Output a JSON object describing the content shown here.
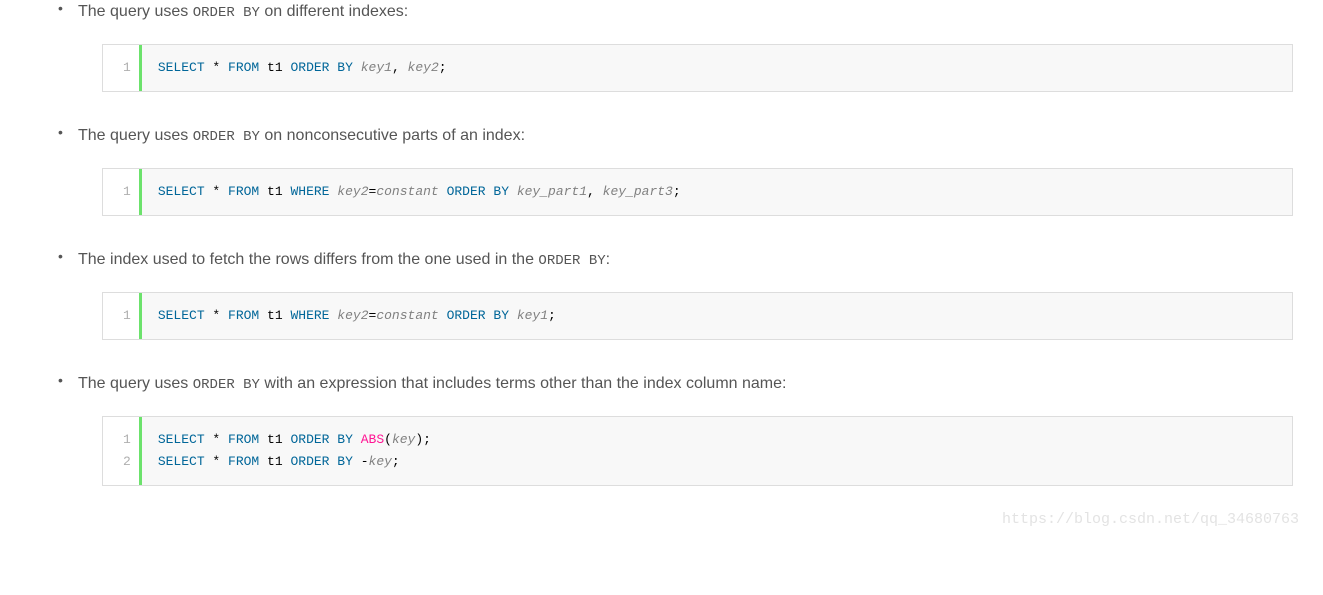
{
  "items": [
    {
      "text_pre": "The query uses ",
      "inline_code": "ORDER BY",
      "text_post": " on different indexes:",
      "line_numbers": [
        "1"
      ],
      "code_lines": [
        [
          {
            "t": "SELECT",
            "c": "kw-blue"
          },
          {
            "t": " * ",
            "c": "plain"
          },
          {
            "t": "FROM",
            "c": "kw-blue"
          },
          {
            "t": " t1 ",
            "c": "plain"
          },
          {
            "t": "ORDER",
            "c": "kw-blue"
          },
          {
            "t": " ",
            "c": "plain"
          },
          {
            "t": "BY",
            "c": "kw-blue"
          },
          {
            "t": " ",
            "c": "plain"
          },
          {
            "t": "key1",
            "c": "gray italic"
          },
          {
            "t": ", ",
            "c": "plain"
          },
          {
            "t": "key2",
            "c": "gray italic"
          },
          {
            "t": ";",
            "c": "plain"
          }
        ]
      ]
    },
    {
      "text_pre": "The query uses ",
      "inline_code": "ORDER BY",
      "text_post": " on nonconsecutive parts of an index:",
      "line_numbers": [
        "1"
      ],
      "code_lines": [
        [
          {
            "t": "SELECT",
            "c": "kw-blue"
          },
          {
            "t": " * ",
            "c": "plain"
          },
          {
            "t": "FROM",
            "c": "kw-blue"
          },
          {
            "t": " t1 ",
            "c": "plain"
          },
          {
            "t": "WHERE",
            "c": "kw-blue"
          },
          {
            "t": " ",
            "c": "plain"
          },
          {
            "t": "key2",
            "c": "gray italic"
          },
          {
            "t": "=",
            "c": "plain"
          },
          {
            "t": "constant",
            "c": "gray italic"
          },
          {
            "t": " ",
            "c": "plain"
          },
          {
            "t": "ORDER",
            "c": "kw-blue"
          },
          {
            "t": " ",
            "c": "plain"
          },
          {
            "t": "BY",
            "c": "kw-blue"
          },
          {
            "t": " ",
            "c": "plain"
          },
          {
            "t": "key_part1",
            "c": "gray italic"
          },
          {
            "t": ", ",
            "c": "plain"
          },
          {
            "t": "key_part3",
            "c": "gray italic"
          },
          {
            "t": ";",
            "c": "plain"
          }
        ]
      ]
    },
    {
      "text_pre": "The index used to fetch the rows differs from the one used in the ",
      "inline_code": "ORDER BY",
      "text_post": ":",
      "line_numbers": [
        "1"
      ],
      "code_lines": [
        [
          {
            "t": "SELECT",
            "c": "kw-blue"
          },
          {
            "t": " * ",
            "c": "plain"
          },
          {
            "t": "FROM",
            "c": "kw-blue"
          },
          {
            "t": " t1 ",
            "c": "plain"
          },
          {
            "t": "WHERE",
            "c": "kw-blue"
          },
          {
            "t": " ",
            "c": "plain"
          },
          {
            "t": "key2",
            "c": "gray italic"
          },
          {
            "t": "=",
            "c": "plain"
          },
          {
            "t": "constant",
            "c": "gray italic"
          },
          {
            "t": " ",
            "c": "plain"
          },
          {
            "t": "ORDER",
            "c": "kw-blue"
          },
          {
            "t": " ",
            "c": "plain"
          },
          {
            "t": "BY",
            "c": "kw-blue"
          },
          {
            "t": " ",
            "c": "plain"
          },
          {
            "t": "key1",
            "c": "gray italic"
          },
          {
            "t": ";",
            "c": "plain"
          }
        ]
      ]
    },
    {
      "text_pre": "The query uses ",
      "inline_code": "ORDER BY",
      "text_post": " with an expression that includes terms other than the index column name:",
      "line_numbers": [
        "1",
        "2"
      ],
      "code_lines": [
        [
          {
            "t": "SELECT",
            "c": "kw-blue"
          },
          {
            "t": " * ",
            "c": "plain"
          },
          {
            "t": "FROM",
            "c": "kw-blue"
          },
          {
            "t": " t1 ",
            "c": "plain"
          },
          {
            "t": "ORDER",
            "c": "kw-blue"
          },
          {
            "t": " ",
            "c": "plain"
          },
          {
            "t": "BY",
            "c": "kw-blue"
          },
          {
            "t": " ",
            "c": "plain"
          },
          {
            "t": "ABS",
            "c": "red"
          },
          {
            "t": "(",
            "c": "plain"
          },
          {
            "t": "key",
            "c": "gray italic"
          },
          {
            "t": ");",
            "c": "plain"
          }
        ],
        [
          {
            "t": "SELECT",
            "c": "kw-blue"
          },
          {
            "t": " * ",
            "c": "plain"
          },
          {
            "t": "FROM",
            "c": "kw-blue"
          },
          {
            "t": " t1 ",
            "c": "plain"
          },
          {
            "t": "ORDER",
            "c": "kw-blue"
          },
          {
            "t": " ",
            "c": "plain"
          },
          {
            "t": "BY",
            "c": "kw-blue"
          },
          {
            "t": " -",
            "c": "plain"
          },
          {
            "t": "key",
            "c": "gray italic"
          },
          {
            "t": ";",
            "c": "plain"
          }
        ]
      ]
    }
  ],
  "watermark": "https://blog.csdn.net/qq_34680763"
}
